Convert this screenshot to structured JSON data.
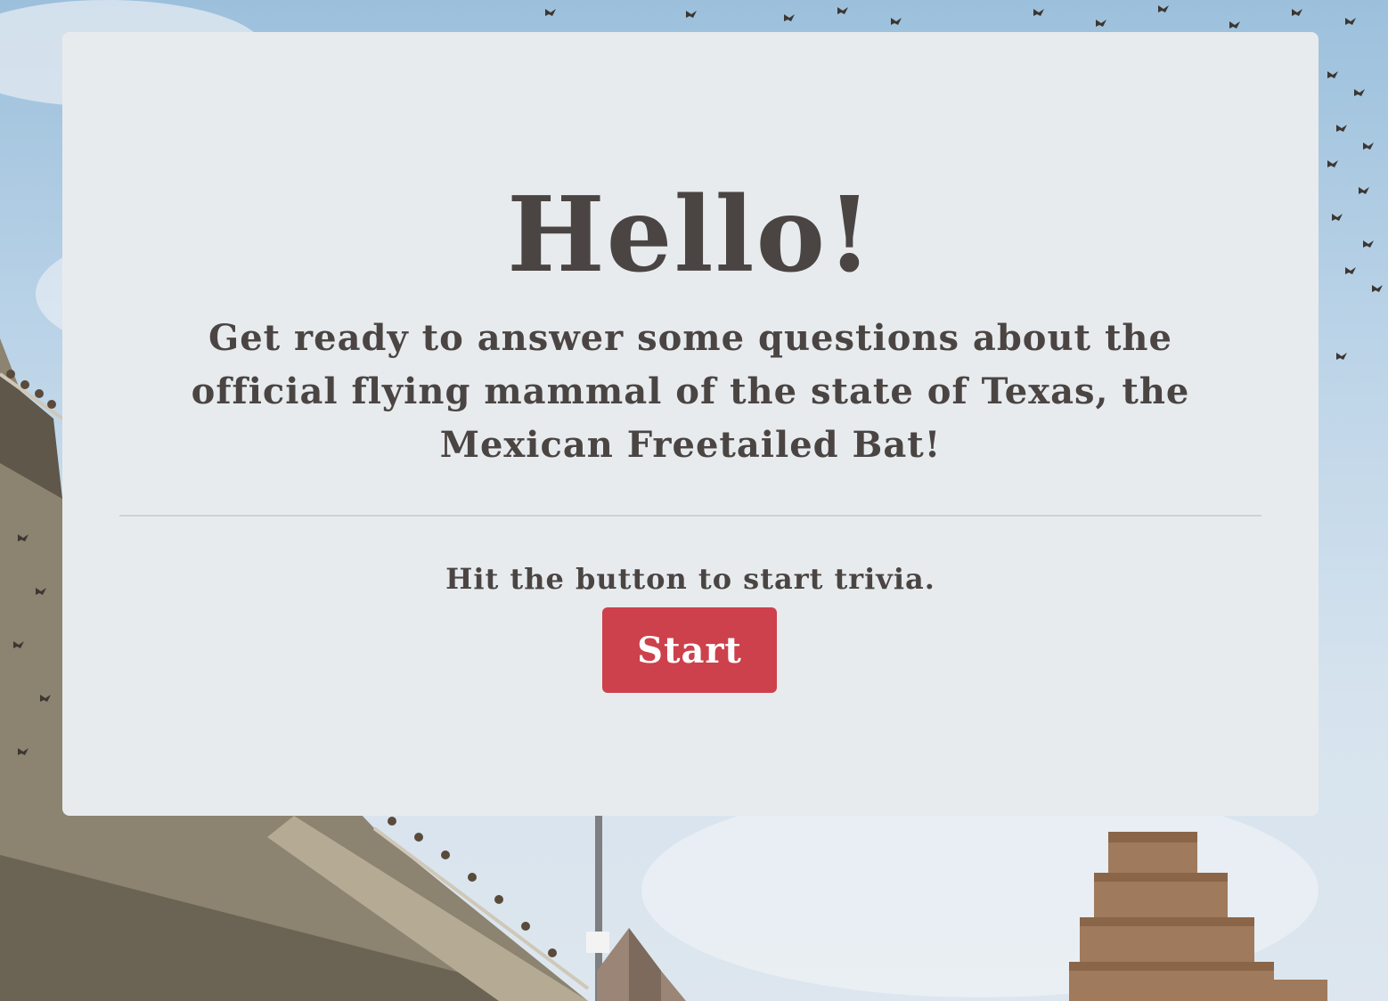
{
  "page": {
    "title": "Hello!",
    "subtitle": "Get ready to answer some questions about the official flying mammal of the state of Texas, the Mexican Freetailed Bat!",
    "prompt": "Hit the button to start trivia.",
    "start_label": "Start"
  },
  "colors": {
    "card_background": "#e8ebee",
    "text": "#4a4543",
    "button": "#cc414b",
    "button_text": "#ffffff"
  },
  "background": {
    "image": "bat-flight-over-congress-avenue-bridge-photo"
  }
}
